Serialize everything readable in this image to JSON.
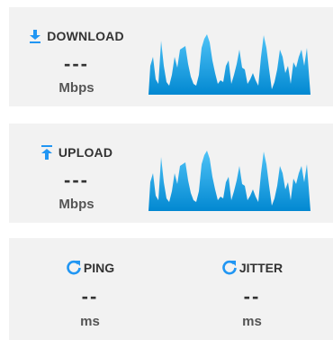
{
  "download": {
    "title": "DOWNLOAD",
    "value": "---",
    "unit": "Mbps",
    "icon": "download-arrow-icon"
  },
  "upload": {
    "title": "UPLOAD",
    "value": "---",
    "unit": "Mbps",
    "icon": "upload-arrow-icon"
  },
  "ping": {
    "title": "PING",
    "value": "--",
    "unit": "ms",
    "icon": "refresh-icon"
  },
  "jitter": {
    "title": "JITTER",
    "value": "--",
    "unit": "ms",
    "icon": "refresh-icon"
  },
  "colors": {
    "accent": "#2196f3",
    "graph_top": "#4fc3f7",
    "graph_bottom": "#0288d1",
    "card_bg": "#f2f2f2"
  }
}
